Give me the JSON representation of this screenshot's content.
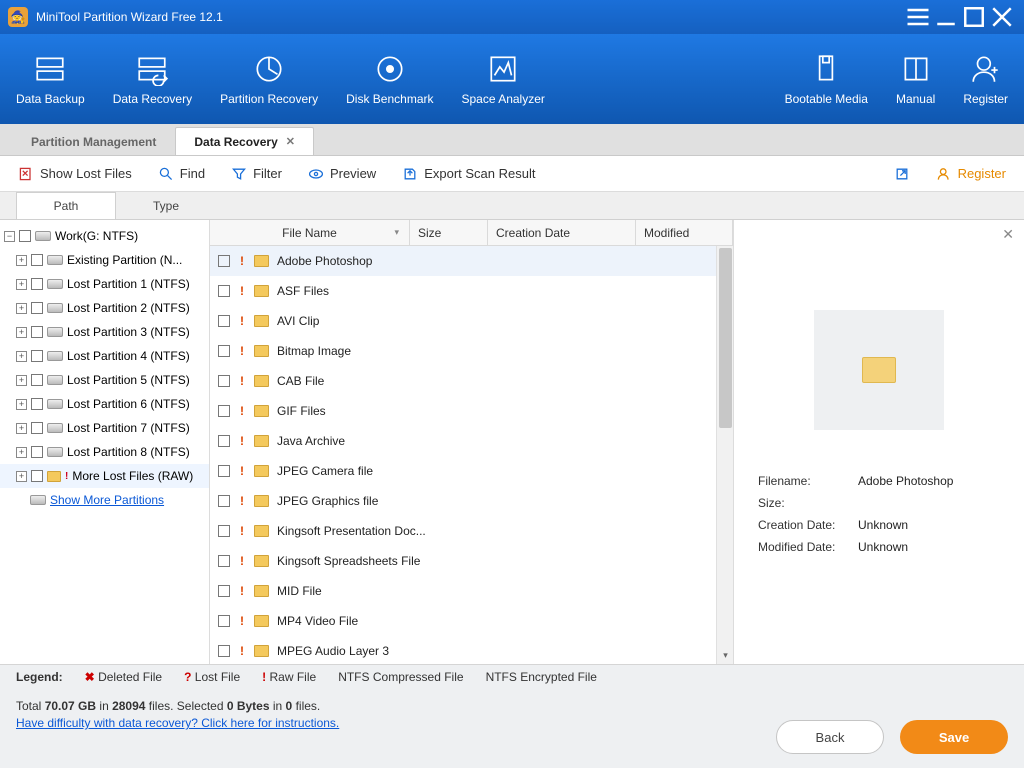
{
  "title": "MiniTool Partition Wizard Free 12.1",
  "ribbon": {
    "left": [
      {
        "id": "data-backup",
        "label": "Data Backup"
      },
      {
        "id": "data-recovery",
        "label": "Data Recovery"
      },
      {
        "id": "partition-recovery",
        "label": "Partition Recovery"
      },
      {
        "id": "disk-benchmark",
        "label": "Disk Benchmark"
      },
      {
        "id": "space-analyzer",
        "label": "Space Analyzer"
      }
    ],
    "right": [
      {
        "id": "bootable-media",
        "label": "Bootable Media"
      },
      {
        "id": "manual",
        "label": "Manual"
      },
      {
        "id": "register",
        "label": "Register"
      }
    ]
  },
  "doctabs": {
    "inactive": "Partition Management",
    "active": "Data Recovery"
  },
  "actionbar": {
    "show_lost": "Show Lost Files",
    "find": "Find",
    "filter": "Filter",
    "preview": "Preview",
    "export": "Export Scan Result",
    "register": "Register"
  },
  "innertabs": {
    "path": "Path",
    "type": "Type"
  },
  "tree": {
    "root": "Work(G: NTFS)",
    "children": [
      "Existing Partition (N...",
      "Lost Partition 1 (NTFS)",
      "Lost Partition 2 (NTFS)",
      "Lost Partition 3 (NTFS)",
      "Lost Partition 4 (NTFS)",
      "Lost Partition 5 (NTFS)",
      "Lost Partition 6 (NTFS)",
      "Lost Partition 7 (NTFS)",
      "Lost Partition 8 (NTFS)"
    ],
    "raw": "More Lost Files (RAW)",
    "showmore": "Show More Partitions"
  },
  "listhdr": {
    "name": "File Name",
    "size": "Size",
    "cdate": "Creation Date",
    "mod": "Modified"
  },
  "files": [
    "Adobe Photoshop",
    "ASF Files",
    "AVI Clip",
    "Bitmap Image",
    "CAB File",
    "GIF Files",
    "Java Archive",
    "JPEG Camera file",
    "JPEG Graphics file",
    "Kingsoft Presentation Doc...",
    "Kingsoft Spreadsheets File",
    "MID File",
    "MP4 Video File",
    "MPEG Audio Layer 3"
  ],
  "detail": {
    "filename_k": "Filename:",
    "filename_v": "Adobe Photoshop",
    "size_k": "Size:",
    "size_v": "",
    "cdate_k": "Creation Date:",
    "cdate_v": "Unknown",
    "mdate_k": "Modified Date:",
    "mdate_v": "Unknown"
  },
  "legend": {
    "label": "Legend:",
    "deleted": "Deleted File",
    "lost": "Lost File",
    "raw": "Raw File",
    "ntfs_comp": "NTFS Compressed File",
    "ntfs_enc": "NTFS Encrypted File"
  },
  "status": {
    "total_a": "Total ",
    "total_b": "70.07 GB",
    "total_c": " in ",
    "total_d": "28094",
    "total_e": " files.  Selected ",
    "sel_a": "0 Bytes",
    "sel_b": " in ",
    "sel_c": "0",
    "sel_d": " files.",
    "help": "Have difficulty with data recovery? Click here for instructions."
  },
  "buttons": {
    "back": "Back",
    "save": "Save"
  }
}
